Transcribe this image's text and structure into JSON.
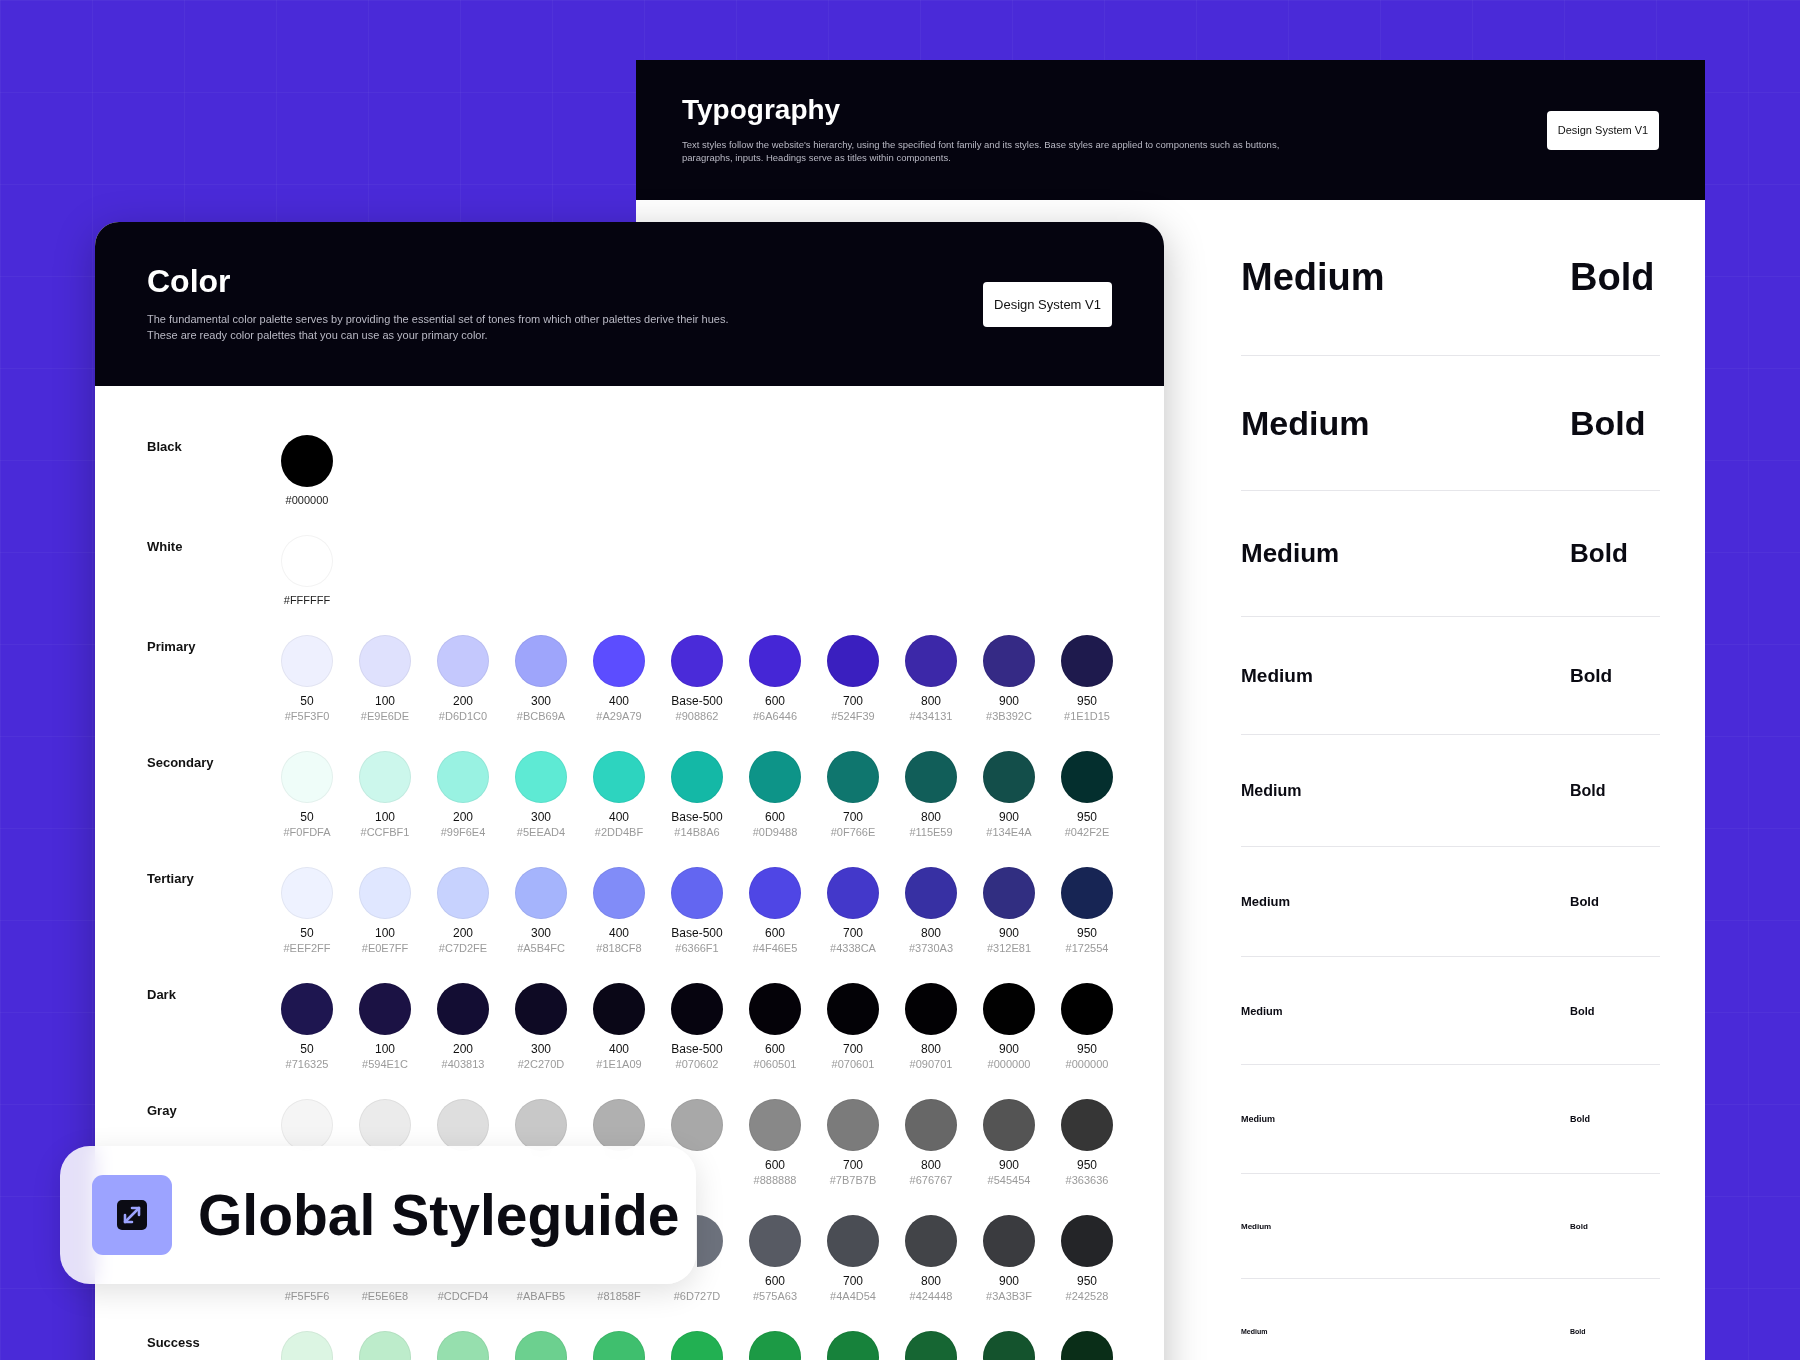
{
  "typography_panel": {
    "title": "Typography",
    "description_lines": [
      "Text styles follow the website's hierarchy, using the specified font family and its styles. Base styles are applied to components such as buttons,",
      "paragraphs, inputs. Headings serve as titles within components."
    ],
    "badge": "Design System V1",
    "rows": [
      {
        "medium": "Medium",
        "bold": "Bold"
      },
      {
        "medium": "Medium",
        "bold": "Bold"
      },
      {
        "medium": "Medium",
        "bold": "Bold"
      },
      {
        "medium": "Medium",
        "bold": "Bold"
      },
      {
        "medium": "Medium",
        "bold": "Bold"
      },
      {
        "medium": "Medium",
        "bold": "Bold"
      },
      {
        "medium": "Medium",
        "bold": "Bold"
      },
      {
        "medium": "Medium",
        "bold": "Bold"
      },
      {
        "medium": "Medium",
        "bold": "Bold"
      },
      {
        "medium": "Medium",
        "bold": "Bold"
      }
    ]
  },
  "color_panel": {
    "title": "Color",
    "description_lines": [
      "The fundamental color palette serves by providing the essential set of tones from which other palettes derive their hues.",
      "These are ready color palettes that you can use as your primary color."
    ],
    "badge": "Design System V1",
    "palettes": [
      {
        "name": "Black",
        "kind": "single",
        "swatches": [
          {
            "color": "#000000",
            "hex": "#000000"
          }
        ]
      },
      {
        "name": "White",
        "kind": "single",
        "swatches": [
          {
            "color": "#ffffff",
            "hex": "#FFFFFF"
          }
        ]
      },
      {
        "name": "Primary",
        "kind": "scale",
        "swatches": [
          {
            "color": "#eef0fe",
            "label": "50",
            "hex": "#F5F3F0"
          },
          {
            "color": "#dfe1fd",
            "label": "100",
            "hex": "#E9E6DE"
          },
          {
            "color": "#c4c8fd",
            "label": "200",
            "hex": "#D6D1C0"
          },
          {
            "color": "#9ea5fb",
            "label": "300",
            "hex": "#BCB69A"
          },
          {
            "color": "#5c4dff",
            "label": "400",
            "hex": "#A29A79"
          },
          {
            "color": "#4a2bd9",
            "label": "Base-500",
            "hex": "#908862"
          },
          {
            "color": "#4526d6",
            "label": "600",
            "hex": "#6A6446"
          },
          {
            "color": "#3a1fbf",
            "label": "700",
            "hex": "#524F39"
          },
          {
            "color": "#3c28a8",
            "label": "800",
            "hex": "#434131"
          },
          {
            "color": "#352a85",
            "label": "900",
            "hex": "#3B392C"
          },
          {
            "color": "#1e1a4d",
            "label": "950",
            "hex": "#1E1D15"
          }
        ]
      },
      {
        "name": "Secondary",
        "kind": "scale",
        "swatches": [
          {
            "color": "#effdf9",
            "label": "50",
            "hex": "#F0FDFA"
          },
          {
            "color": "#ccf7ec",
            "label": "100",
            "hex": "#CCFBF1"
          },
          {
            "color": "#99f2e2",
            "label": "200",
            "hex": "#99F6E4"
          },
          {
            "color": "#5eead4",
            "label": "300",
            "hex": "#5EEAD4"
          },
          {
            "color": "#2dd4bf",
            "label": "400",
            "hex": "#2DD4BF"
          },
          {
            "color": "#14b8a6",
            "label": "Base-500",
            "hex": "#14B8A6"
          },
          {
            "color": "#0d9488",
            "label": "600",
            "hex": "#0D9488"
          },
          {
            "color": "#0f766e",
            "label": "700",
            "hex": "#0F766E"
          },
          {
            "color": "#115e59",
            "label": "800",
            "hex": "#115E59"
          },
          {
            "color": "#134e4a",
            "label": "900",
            "hex": "#134E4A"
          },
          {
            "color": "#042f2e",
            "label": "950",
            "hex": "#042F2E"
          }
        ]
      },
      {
        "name": "Tertiary",
        "kind": "scale",
        "swatches": [
          {
            "color": "#eef2ff",
            "label": "50",
            "hex": "#EEF2FF"
          },
          {
            "color": "#e0e7ff",
            "label": "100",
            "hex": "#E0E7FF"
          },
          {
            "color": "#c7d2fe",
            "label": "200",
            "hex": "#C7D2FE"
          },
          {
            "color": "#a5b4fc",
            "label": "300",
            "hex": "#A5B4FC"
          },
          {
            "color": "#818cf8",
            "label": "400",
            "hex": "#818CF8"
          },
          {
            "color": "#6366f1",
            "label": "Base-500",
            "hex": "#6366F1"
          },
          {
            "color": "#4f46e5",
            "label": "600",
            "hex": "#4F46E5"
          },
          {
            "color": "#4338ca",
            "label": "700",
            "hex": "#4338CA"
          },
          {
            "color": "#3730a3",
            "label": "800",
            "hex": "#3730A3"
          },
          {
            "color": "#312e81",
            "label": "900",
            "hex": "#312E81"
          },
          {
            "color": "#172554",
            "label": "950",
            "hex": "#172554"
          }
        ]
      },
      {
        "name": "Dark",
        "kind": "scale",
        "swatches": [
          {
            "color": "#1e1650",
            "label": "50",
            "hex": "#716325"
          },
          {
            "color": "#1b1244",
            "label": "100",
            "hex": "#594E1C"
          },
          {
            "color": "#130d33",
            "label": "200",
            "hex": "#403813"
          },
          {
            "color": "#0e0a24",
            "label": "300",
            "hex": "#2C270D"
          },
          {
            "color": "#0a0717",
            "label": "400",
            "hex": "#1E1A09"
          },
          {
            "color": "#06040f",
            "label": "Base-500",
            "hex": "#070602"
          },
          {
            "color": "#040208",
            "label": "600",
            "hex": "#060501"
          },
          {
            "color": "#030206",
            "label": "700",
            "hex": "#070601"
          },
          {
            "color": "#020104",
            "label": "800",
            "hex": "#090701"
          },
          {
            "color": "#010101",
            "label": "900",
            "hex": "#000000"
          },
          {
            "color": "#000000",
            "label": "950",
            "hex": "#000000"
          }
        ]
      },
      {
        "name": "Gray",
        "kind": "scale",
        "swatches": [
          {
            "color": "#f5f5f5"
          },
          {
            "color": "#ebebeb"
          },
          {
            "color": "#dedede"
          },
          {
            "color": "#c8c8c8"
          },
          {
            "color": "#b0b0b0"
          },
          {
            "color": "#a8a8a8"
          },
          {
            "color": "#888888",
            "label": "600",
            "hex": "#888888"
          },
          {
            "color": "#7b7b7b",
            "label": "700",
            "hex": "#7B7B7B"
          },
          {
            "color": "#676767",
            "label": "800",
            "hex": "#676767"
          },
          {
            "color": "#545454",
            "label": "900",
            "hex": "#545454"
          },
          {
            "color": "#363636",
            "label": "950",
            "hex": "#363636"
          }
        ]
      },
      {
        "kind": "scale",
        "swatches": [
          {
            "hex": "#F5F5F6"
          },
          {
            "hex": "#E5E6E8"
          },
          {
            "hex": "#CDCFD4"
          },
          {
            "hex": "#ABAFB5"
          },
          {
            "hex": "#81858F"
          },
          {
            "color": "#6d727d",
            "hex": "#6D727D",
            "partial": true
          },
          {
            "color": "#575a63",
            "label": "600",
            "hex": "#575A63"
          },
          {
            "color": "#4a4d54",
            "label": "700",
            "hex": "#4A4D54"
          },
          {
            "color": "#424448",
            "label": "800",
            "hex": "#424448"
          },
          {
            "color": "#3a3b3f",
            "label": "900",
            "hex": "#3A3B3F"
          },
          {
            "color": "#242528",
            "label": "950",
            "hex": "#242528"
          }
        ]
      },
      {
        "name": "Success",
        "kind": "scale",
        "swatches": [
          {
            "color": "#dcf5e3"
          },
          {
            "color": "#bdeccb"
          },
          {
            "color": "#96dfae"
          },
          {
            "color": "#6cd08f"
          },
          {
            "color": "#3fbf6e"
          },
          {
            "color": "#22b052"
          },
          {
            "color": "#1c9a45"
          },
          {
            "color": "#17823b"
          },
          {
            "color": "#166633"
          },
          {
            "color": "#14532d"
          },
          {
            "color": "#0a2e18"
          }
        ]
      }
    ]
  },
  "overlay": {
    "title": "Global Styleguide"
  }
}
